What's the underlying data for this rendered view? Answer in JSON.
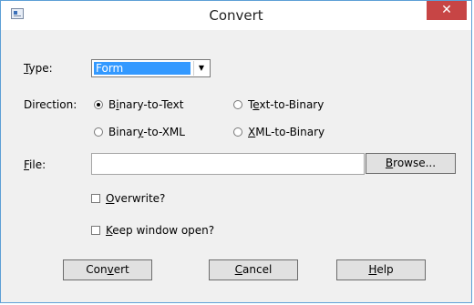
{
  "window": {
    "title": "Convert",
    "close_glyph": "✕",
    "icon": "app-icon"
  },
  "form": {
    "type_label": "Type:",
    "type_value": "Form",
    "direction_label": "Direction:",
    "directions": [
      {
        "label": "Binary-to-Text",
        "checked": true
      },
      {
        "label": "Text-to-Binary",
        "checked": false
      },
      {
        "label": "Binary-to-XML",
        "checked": false
      },
      {
        "label": "XML-to-Binary",
        "checked": false
      }
    ],
    "file_label": "File:",
    "file_value": "",
    "browse_label": "Browse...",
    "overwrite_label": "Overwrite?",
    "overwrite_checked": false,
    "keep_open_label": "Keep window open?",
    "keep_open_checked": false
  },
  "buttons": {
    "convert": "Convert",
    "cancel": "Cancel",
    "help": "Help"
  }
}
